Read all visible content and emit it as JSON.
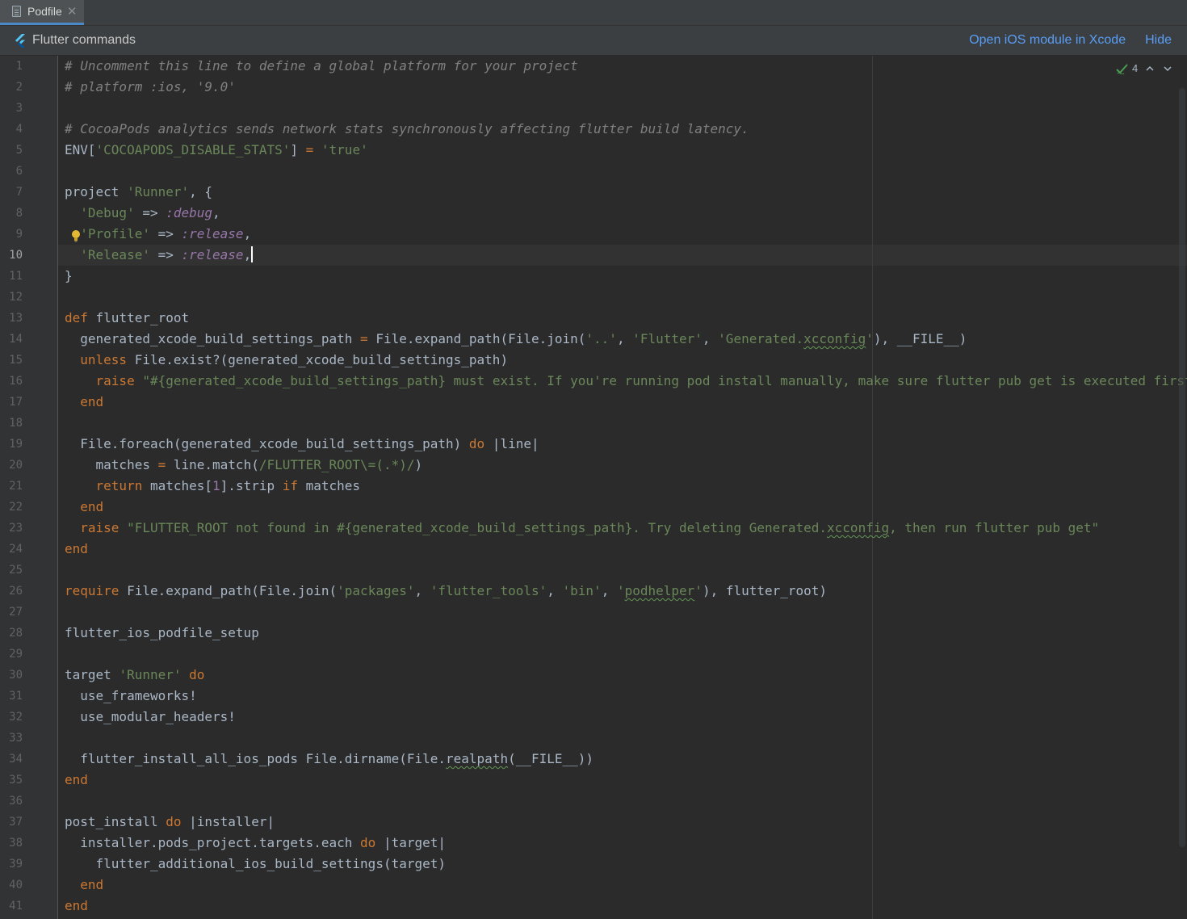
{
  "tab": {
    "label": "Podfile",
    "close": "✕"
  },
  "banner": {
    "title": "Flutter commands",
    "open_xcode": "Open iOS module in Xcode",
    "hide": "Hide"
  },
  "inspection": {
    "count": "4"
  },
  "editor": {
    "active_line": 10
  },
  "code": [
    [
      [
        "c",
        "# Uncomment this line to define a global platform for your project"
      ]
    ],
    [
      [
        "c",
        "# platform :ios, '9.0'"
      ]
    ],
    [],
    [
      [
        "c",
        "# CocoaPods analytics sends network stats synchronously affecting flutter build latency."
      ]
    ],
    [
      [
        "p",
        "ENV["
      ],
      [
        "s",
        "'COCOAPODS_DISABLE_STATS'"
      ],
      [
        "p",
        "] "
      ],
      [
        "o",
        "="
      ],
      [
        "p",
        " "
      ],
      [
        "s",
        "'true'"
      ]
    ],
    [],
    [
      [
        "p",
        "project "
      ],
      [
        "s",
        "'Runner'"
      ],
      [
        "p",
        ", {"
      ]
    ],
    [
      [
        "p",
        "  "
      ],
      [
        "s",
        "'Debug'"
      ],
      [
        "p",
        " => "
      ],
      [
        "y",
        ":debug"
      ],
      [
        "p",
        ","
      ]
    ],
    [
      [
        "p",
        "  "
      ],
      [
        "s",
        "'Profile'"
      ],
      [
        "p",
        " => "
      ],
      [
        "y",
        ":release"
      ],
      [
        "p",
        ","
      ]
    ],
    [
      [
        "p",
        "  "
      ],
      [
        "s",
        "'Release'"
      ],
      [
        "p",
        " => "
      ],
      [
        "y",
        ":release"
      ],
      [
        "p",
        ","
      ],
      [
        "cursor",
        ""
      ]
    ],
    [
      [
        "p",
        "}"
      ]
    ],
    [],
    [
      [
        "k",
        "def"
      ],
      [
        "p",
        " flutter_root"
      ]
    ],
    [
      [
        "p",
        "  generated_xcode_build_settings_path "
      ],
      [
        "o",
        "="
      ],
      [
        "p",
        " File.expand_path(File.join("
      ],
      [
        "s",
        "'..'"
      ],
      [
        "p",
        ", "
      ],
      [
        "s",
        "'Flutter'"
      ],
      [
        "p",
        ", "
      ],
      [
        "s",
        "'Generated."
      ],
      [
        "st",
        "xcconfig"
      ],
      [
        "s",
        "'"
      ],
      [
        "p",
        "), __FILE__)"
      ]
    ],
    [
      [
        "p",
        "  "
      ],
      [
        "k",
        "unless"
      ],
      [
        "p",
        " File.exist?(generated_xcode_build_settings_path)"
      ]
    ],
    [
      [
        "p",
        "    "
      ],
      [
        "k",
        "raise"
      ],
      [
        "p",
        " "
      ],
      [
        "s",
        "\"#{generated_xcode_build_settings_path} must exist. If you're running pod install manually, make sure flutter pub get is executed first\""
      ]
    ],
    [
      [
        "p",
        "  "
      ],
      [
        "k",
        "end"
      ]
    ],
    [],
    [
      [
        "p",
        "  File.foreach(generated_xcode_build_settings_path) "
      ],
      [
        "k",
        "do"
      ],
      [
        "p",
        " |line|"
      ]
    ],
    [
      [
        "p",
        "    matches "
      ],
      [
        "o",
        "="
      ],
      [
        "p",
        " line.match("
      ],
      [
        "s",
        "/FLUTTER_ROOT\\=(.*)/"
      ],
      [
        "p",
        ")"
      ]
    ],
    [
      [
        "p",
        "    "
      ],
      [
        "k",
        "return"
      ],
      [
        "p",
        " matches["
      ],
      [
        "n",
        "1"
      ],
      [
        "p",
        "].strip "
      ],
      [
        "k",
        "if"
      ],
      [
        "p",
        " matches"
      ]
    ],
    [
      [
        "p",
        "  "
      ],
      [
        "k",
        "end"
      ]
    ],
    [
      [
        "p",
        "  "
      ],
      [
        "k",
        "raise"
      ],
      [
        "p",
        " "
      ],
      [
        "s",
        "\"FLUTTER_ROOT not found in #{generated_xcode_build_settings_path}. Try deleting Generated."
      ],
      [
        "st",
        "xcconfig"
      ],
      [
        "s",
        ", then run flutter pub get\""
      ]
    ],
    [
      [
        "k",
        "end"
      ]
    ],
    [],
    [
      [
        "k",
        "require"
      ],
      [
        "p",
        " File.expand_path(File.join("
      ],
      [
        "s",
        "'packages'"
      ],
      [
        "p",
        ", "
      ],
      [
        "s",
        "'flutter_tools'"
      ],
      [
        "p",
        ", "
      ],
      [
        "s",
        "'bin'"
      ],
      [
        "p",
        ", "
      ],
      [
        "s",
        "'"
      ],
      [
        "st",
        "podhelper"
      ],
      [
        "s",
        "'"
      ],
      [
        "p",
        "), flutter_root)"
      ]
    ],
    [],
    [
      [
        "p",
        "flutter_ios_podfile_setup"
      ]
    ],
    [],
    [
      [
        "p",
        "target "
      ],
      [
        "s",
        "'Runner'"
      ],
      [
        "p",
        " "
      ],
      [
        "k",
        "do"
      ]
    ],
    [
      [
        "p",
        "  use_frameworks!"
      ]
    ],
    [
      [
        "p",
        "  use_modular_headers!"
      ]
    ],
    [],
    [
      [
        "p",
        "  flutter_install_all_ios_pods File.dirname(File."
      ],
      [
        "pt",
        "realpath"
      ],
      [
        "p",
        "(__FILE__))"
      ]
    ],
    [
      [
        "k",
        "end"
      ]
    ],
    [],
    [
      [
        "p",
        "post_install "
      ],
      [
        "k",
        "do"
      ],
      [
        "p",
        " |installer|"
      ]
    ],
    [
      [
        "p",
        "  installer.pods_project.targets.each "
      ],
      [
        "k",
        "do"
      ],
      [
        "p",
        " |target|"
      ]
    ],
    [
      [
        "p",
        "    flutter_additional_ios_build_settings(target)"
      ]
    ],
    [
      [
        "p",
        "  "
      ],
      [
        "k",
        "end"
      ]
    ],
    [
      [
        "k",
        "end"
      ]
    ]
  ]
}
